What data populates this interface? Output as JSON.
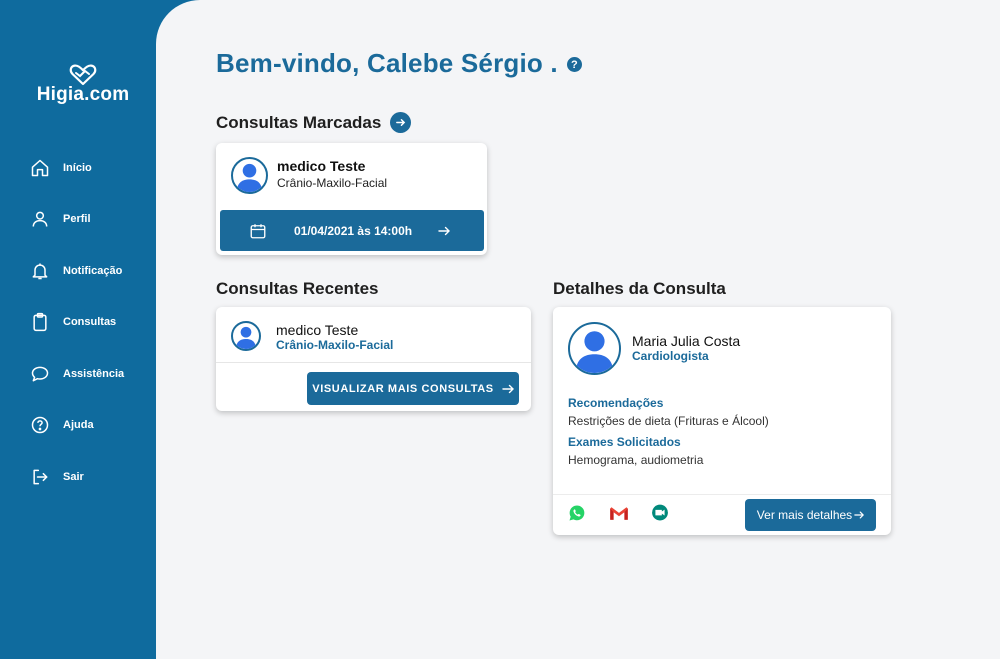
{
  "app": {
    "logo_text": "Higia.com"
  },
  "sidebar": {
    "items": [
      {
        "label": "Início",
        "icon": "home-icon"
      },
      {
        "label": "Perfil",
        "icon": "user-icon"
      },
      {
        "label": "Notificação",
        "icon": "bell-icon"
      },
      {
        "label": "Consultas",
        "icon": "clipboard-icon"
      },
      {
        "label": "Assistência",
        "icon": "chat-icon"
      },
      {
        "label": "Ajuda",
        "icon": "help-circle-icon"
      },
      {
        "label": "Sair",
        "icon": "logout-icon"
      }
    ]
  },
  "header": {
    "welcome": "Bem-vindo, Calebe Sérgio .",
    "help_glyph": "?"
  },
  "scheduled": {
    "title": "Consultas Marcadas",
    "doctor": "medico Teste",
    "specialty": "Crânio-Maxilo-Facial",
    "datetime": "01/04/2021 às 14:00h"
  },
  "recent": {
    "title": "Consultas Recentes",
    "doctor": "medico Teste",
    "specialty": "Crânio-Maxilo-Facial",
    "button_label": "VISUALIZAR MAIS CONSULTAS"
  },
  "details": {
    "title": "Detalhes da Consulta",
    "doctor": "Maria Julia Costa",
    "specialty": "Cardiologista",
    "recommendations_label": "Recomendações",
    "recommendations": "Restrições de dieta (Frituras e Álcool)",
    "exams_label": "Exames Solicitados",
    "exams": "Hemograma, audiometria",
    "button_label": "Ver mais detalhes",
    "contact_icons": [
      "whatsapp-icon",
      "gmail-icon",
      "meet-icon"
    ]
  },
  "colors": {
    "primary": "#1b6a9a",
    "sidebar": "#0f6b9e",
    "background": "#f4f5f7",
    "avatar": "#2f6fe4"
  }
}
